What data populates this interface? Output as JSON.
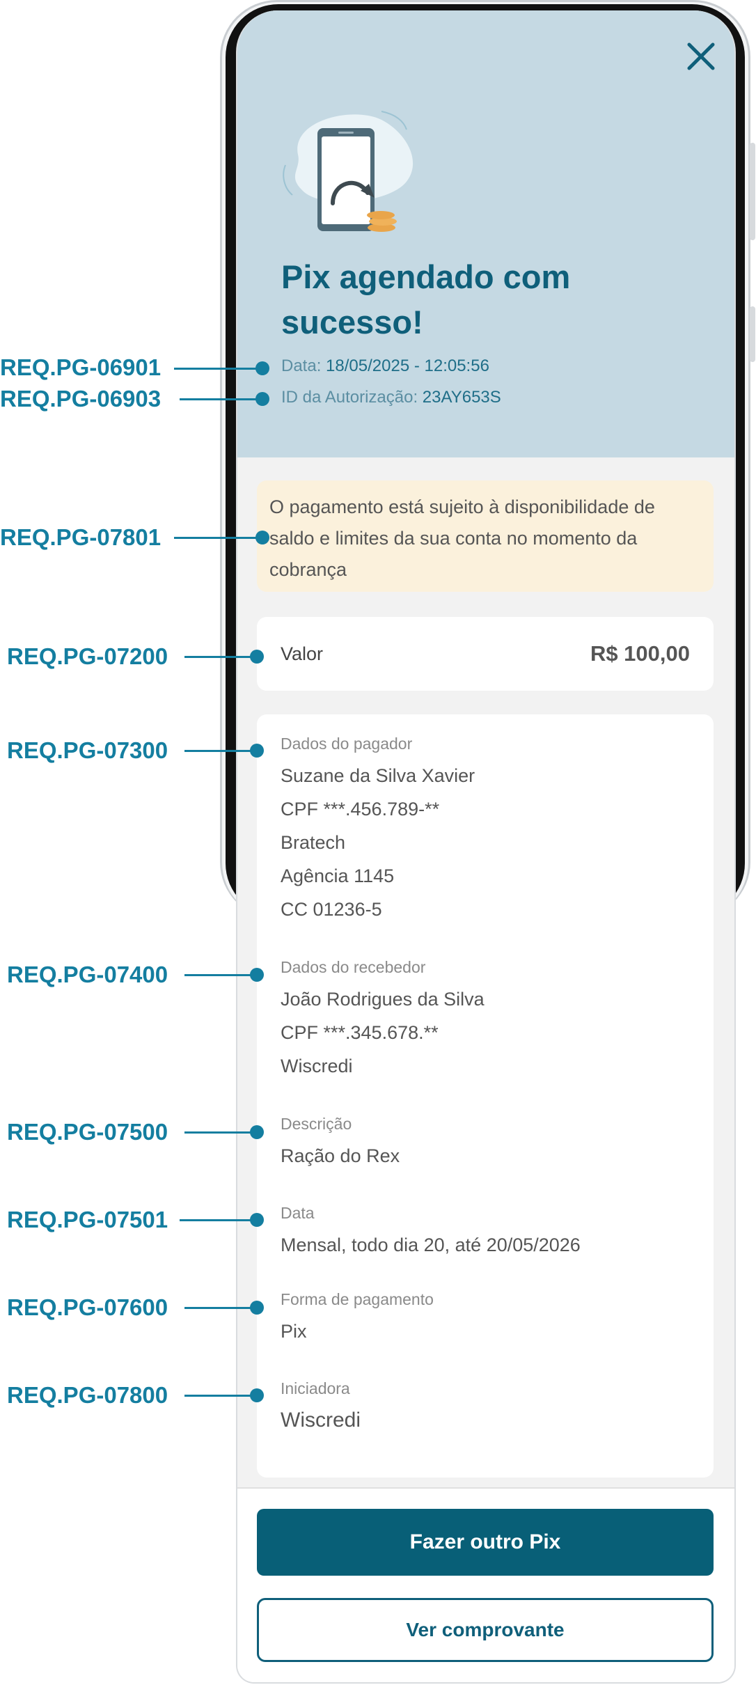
{
  "header": {
    "title": "Pix agendado com sucesso!",
    "date_label": "Data:",
    "date_value": "18/05/2025 - 12:05:56",
    "auth_label": "ID da Autorização:",
    "auth_value": "23AY653S",
    "close_icon": "close-icon",
    "illustration_icon": "phone-transfer-icon"
  },
  "notice": {
    "text": "O pagamento está sujeito à disponibilidade de saldo e limites da sua conta no momento da cobrança"
  },
  "amount": {
    "label": "Valor",
    "value": "R$ 100,00"
  },
  "details": {
    "payer": {
      "title": "Dados do pagador",
      "name": "Suzane da Silva Xavier",
      "cpf": "CPF ***.456.789-**",
      "institution": "Bratech",
      "agency": "Agência 1145",
      "account": "CC 01236-5"
    },
    "receiver": {
      "title": "Dados do recebedor",
      "name": "João Rodrigues da Silva",
      "cpf": "CPF ***.345.678.**",
      "institution": "Wiscredi"
    },
    "description": {
      "title": "Descrição",
      "value": "Ração do Rex"
    },
    "schedule": {
      "title": "Data",
      "value": "Mensal, todo dia 20, até 20/05/2026"
    },
    "payment_method": {
      "title": "Forma de pagamento",
      "value": "Pix"
    },
    "initiator": {
      "title": "Iniciadora",
      "value": "Wiscredi"
    }
  },
  "actions": {
    "primary_label": "Fazer outro Pix",
    "secondary_label": "Ver comprovante"
  },
  "annotations": [
    "REQ.PG-06901",
    "REQ.PG-06903",
    "REQ.PG-07801",
    "REQ.PG-07200",
    "REQ.PG-07300",
    "REQ.PG-07400",
    "REQ.PG-07500",
    "REQ.PG-07501",
    "REQ.PG-07600",
    "REQ.PG-07800"
  ],
  "colors": {
    "brand": "#085f77",
    "header_bg": "#c5d9e3",
    "notice_bg": "#fbf1dc",
    "annotation": "#147ea0"
  }
}
